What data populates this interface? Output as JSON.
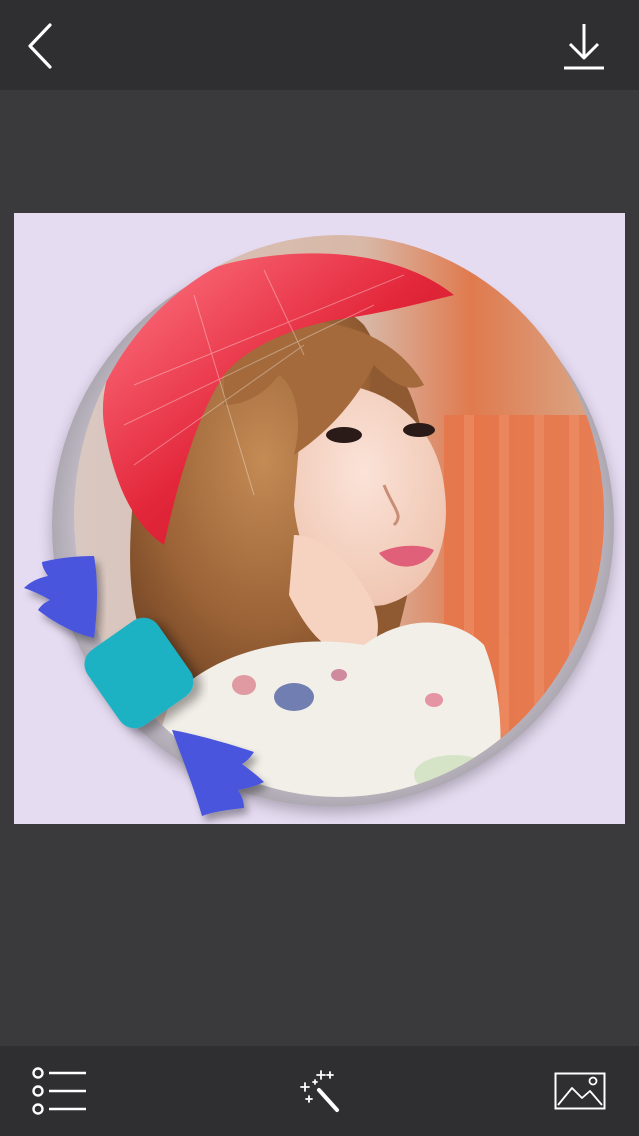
{
  "app": {
    "background_color": "#3a393b",
    "bar_color": "#2f2e30",
    "icon_color": "#ffffff"
  },
  "top_bar": {
    "back_icon": "chevron-left-icon",
    "download_icon": "download-icon"
  },
  "editor": {
    "frame_color": "#e6dcf2",
    "photo": "girl-red-beanie-photo",
    "stickers": [
      {
        "name": "left-arrow-sticker",
        "color": "#4a55dd"
      },
      {
        "name": "teal-diamond-sticker",
        "color": "#1fb2c4"
      },
      {
        "name": "right-arrow-sticker",
        "color": "#4a55dd"
      }
    ]
  },
  "bottom_bar": {
    "list_icon": "list-icon",
    "magic_icon": "magic-wand-icon",
    "gallery_icon": "image-gallery-icon"
  }
}
